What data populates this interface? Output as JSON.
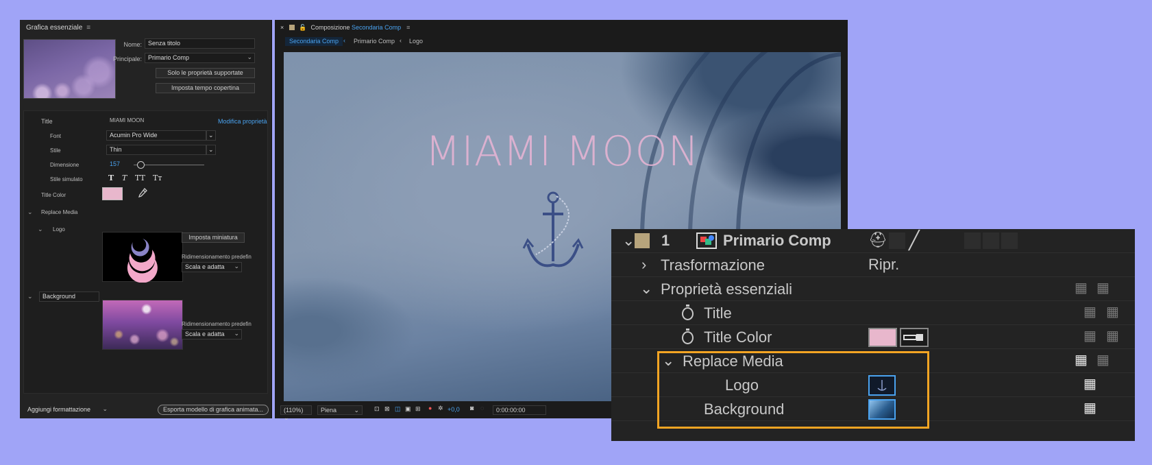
{
  "left_panel": {
    "tab_title": "Grafica essenziale",
    "name_label": "Nome:",
    "name_value": "Senza titolo",
    "primary_label": "Principale:",
    "primary_value": "Primario Comp",
    "btn_supported": "Solo le proprietà supportate",
    "btn_poster": "Imposta tempo copertina",
    "title_label": "Title",
    "title_value": "MIAMI MOON",
    "edit_props": "Modifica proprietà",
    "font_label": "Font",
    "font_value": "Acumin Pro Wide",
    "style_label": "Stile",
    "style_value": "Thin",
    "size_label": "Dimensione",
    "size_value": "157",
    "faux_label": "Stile simulato",
    "faux_glyphs": [
      "T",
      "T",
      "TT",
      "Tт"
    ],
    "title_color_label": "Title Color",
    "replace_media_label": "Replace Media",
    "logo_label": "Logo",
    "set_thumb": "Imposta miniatura",
    "resize_label": "Ridimensionamento predefin",
    "scale_value": "Scala e adatta",
    "background_label": "Background",
    "add_format": "Aggiungi formattazione",
    "export_btn": "Esporta modello di grafica animata..."
  },
  "comp_panel": {
    "close": "×",
    "tab_prefix": "Composizione",
    "tab_name": "Secondaria Comp",
    "crumbs": [
      "Secondaria Comp",
      "Primario Comp",
      "Logo"
    ],
    "overlay_title": "MIAMI MOON",
    "zoom": "(110%)",
    "resolution": "Piena",
    "exposure": "+0,0",
    "timecode": "0:00:00:00"
  },
  "timeline": {
    "layer_number": "1",
    "layer_name": "Primario Comp",
    "transform": "Trasformazione",
    "reset": "Ripr.",
    "essential": "Proprietà essenziali",
    "title": "Title",
    "title_color": "Title Color",
    "replace_media": "Replace Media",
    "logo": "Logo",
    "background": "Background"
  },
  "colors": {
    "title_color": "#e8b7cc",
    "accent_blue": "#4aa3f0",
    "highlight": "#f5a523",
    "label_tan": "#b7a47c"
  }
}
